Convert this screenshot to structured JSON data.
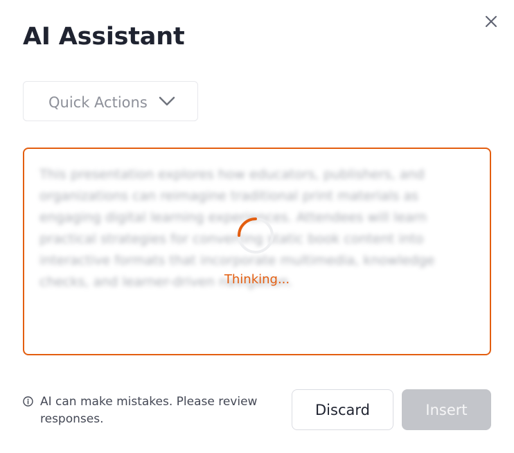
{
  "dialog": {
    "title": "AI Assistant",
    "close_icon": "close-icon"
  },
  "quick_actions": {
    "label": "Quick Actions",
    "icon": "chevron-down-icon"
  },
  "panel": {
    "preview_text": "This presentation explores how educators, publishers, and organizations can reimagine traditional print materials as engaging digital learning experiences. Attendees will learn practical strategies for converting static book content into interactive formats that incorporate multimedia, knowledge checks, and learner-driven navigation.",
    "status_text": "Thinking...",
    "accent_color": "#e35e10"
  },
  "footer": {
    "disclaimer": "AI can make mistakes. Please review responses.",
    "info_icon": "info-icon",
    "discard_label": "Discard",
    "insert_label": "Insert"
  }
}
